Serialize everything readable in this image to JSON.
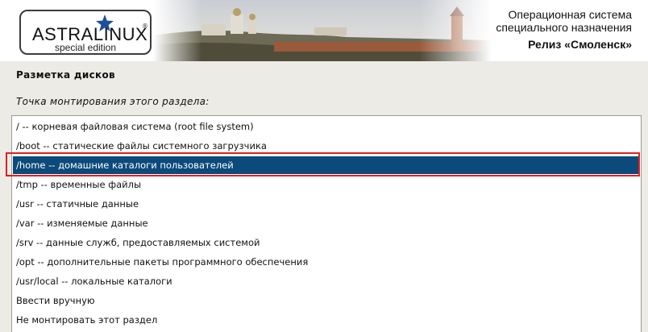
{
  "header": {
    "logo_title": "ASTRALINUX",
    "logo_reg": "®",
    "logo_subtitle": "special edition",
    "line1": "Операционная система",
    "line2": "специального назначения",
    "line3": "Релиз «Смоленск»"
  },
  "page": {
    "title": "Разметка дисков",
    "question": "Точка монтирования этого раздела:"
  },
  "options": [
    "/ -- корневая файловая система (root file system)",
    "/boot -- статические файлы системного загрузчика",
    "/home -- домашние каталоги пользователей",
    "/tmp -- временные файлы",
    "/usr -- статичные данные",
    "/var -- изменяемые данные",
    "/srv -- данные служб, предоставляемых системой",
    "/opt -- дополнительные пакеты программного обеспечения",
    "/usr/local -- локальные каталоги",
    "Ввести вручную",
    "Не монтировать этот раздел"
  ],
  "selected_option": "/home -- домашние каталоги пользователей",
  "colors": {
    "selection_bg": "#0b4a7a",
    "highlight_border": "#e02020",
    "star": "#1d4f9a"
  }
}
